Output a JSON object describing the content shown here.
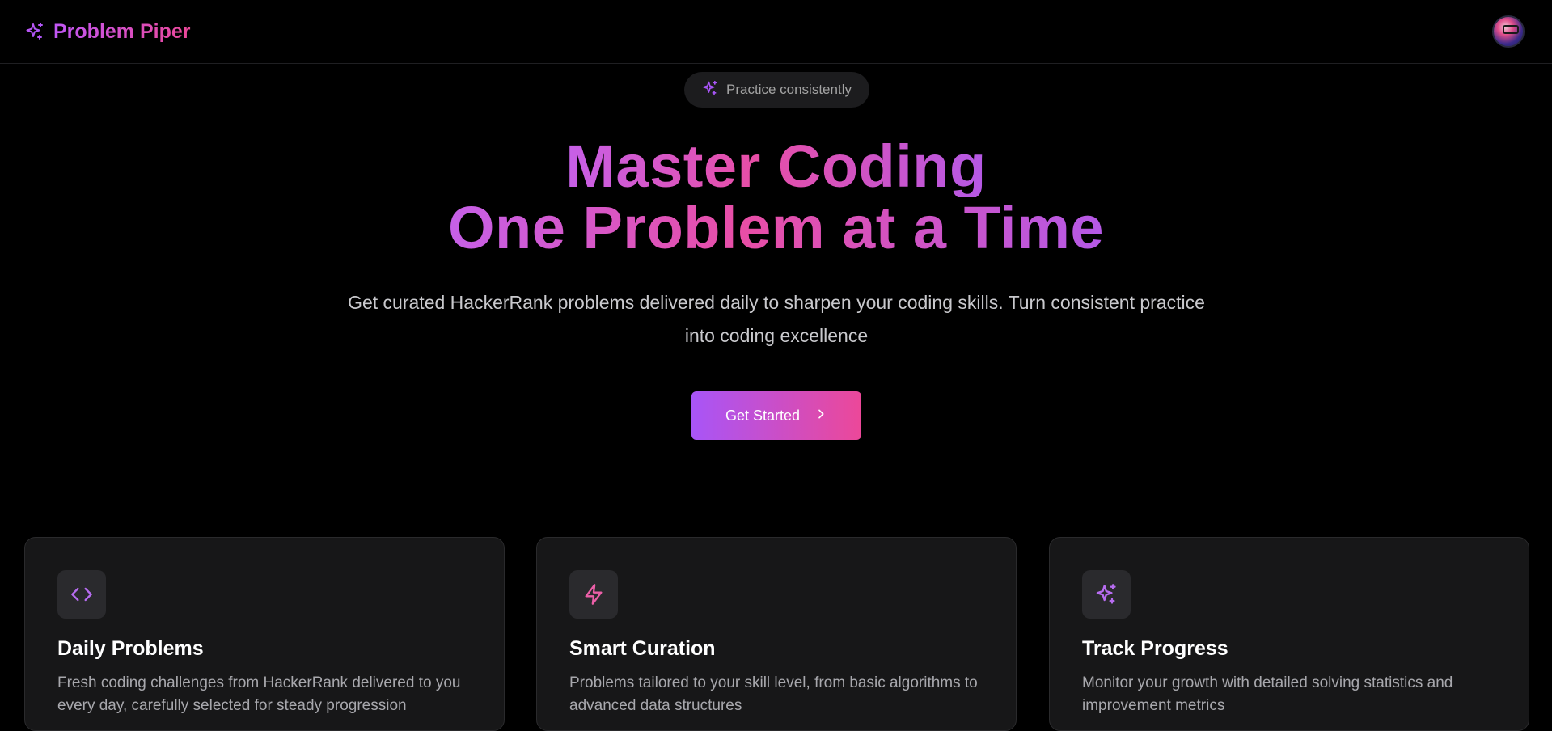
{
  "brand": {
    "name": "Problem Piper",
    "icon": "sparkles-icon"
  },
  "user": {
    "avatar_icon": "avatar"
  },
  "badge": {
    "label": "Practice consistently",
    "icon": "sparkles-icon"
  },
  "hero": {
    "title_line1": "Master Coding",
    "title_line2": "One Problem at a Time",
    "subtitle": "Get curated HackerRank problems delivered daily to sharpen your coding skills. Turn consistent practice into coding excellence",
    "cta_label": "Get Started",
    "cta_icon": "chevron-right-icon"
  },
  "features": [
    {
      "title": "Daily Problems",
      "description": "Fresh coding challenges from HackerRank delivered to you every day, carefully selected for steady progression",
      "icon": "code-icon"
    },
    {
      "title": "Smart Curation",
      "description": "Problems tailored to your skill level, from basic algorithms to advanced data structures",
      "icon": "lightning-icon"
    },
    {
      "title": "Track Progress",
      "description": "Monitor your growth with detailed solving statistics and improvement metrics",
      "icon": "sparkles-icon"
    }
  ],
  "colors": {
    "background": "#000000",
    "accent_purple": "#a855f7",
    "accent_pink": "#ec4899",
    "card_bg": "#171718",
    "muted_text": "#a8a8ad"
  }
}
